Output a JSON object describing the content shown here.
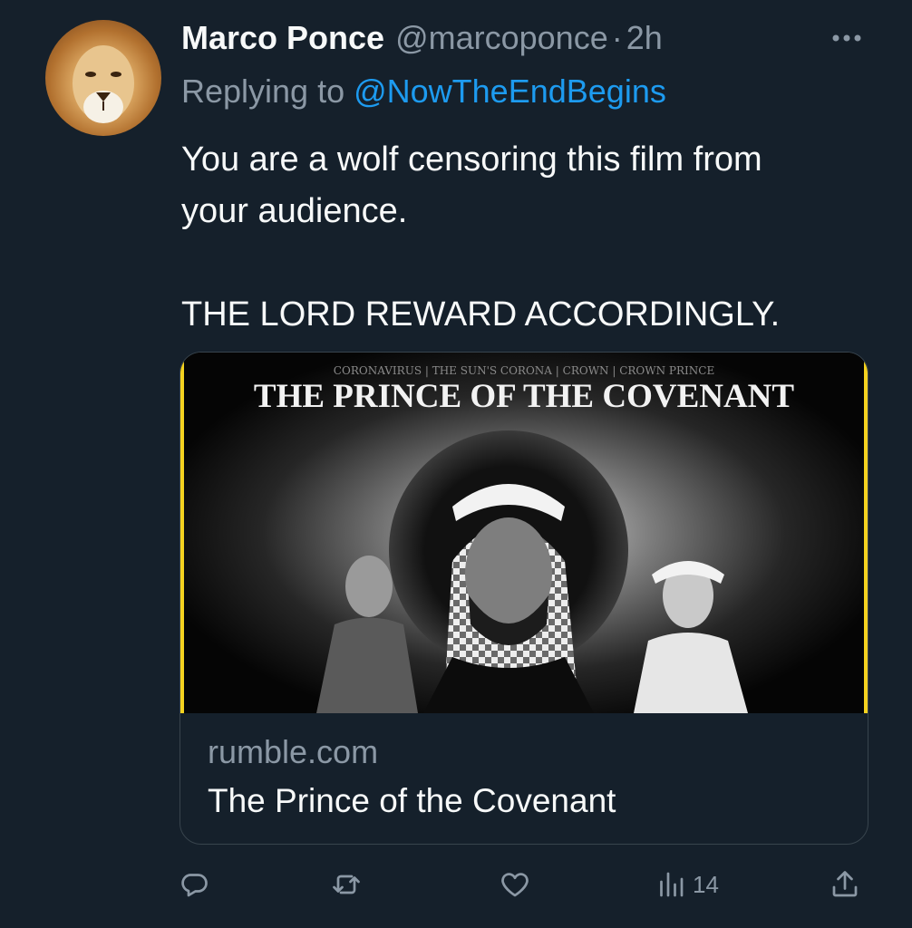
{
  "tweet": {
    "author_name": "Marco Ponce",
    "author_handle": "@marcoponce",
    "separator": "·",
    "time": "2h",
    "replying_prefix": "Replying to ",
    "replying_to": "@NowTheEndBegins",
    "body_lines": [
      "You are a wolf censoring this film from",
      "your audience.",
      "THE LORD REWARD ACCORDINGLY."
    ]
  },
  "card": {
    "image_title": "THE PRINCE OF THE COVENANT",
    "image_subtitle": "CORONAVIRUS | THE SUN'S CORONA | CROWN | CROWN PRINCE",
    "domain": "rumble.com",
    "title": "The Prince of the Covenant"
  },
  "actions": {
    "reply_icon": "reply-icon",
    "retweet_icon": "retweet-icon",
    "like_icon": "heart-icon",
    "views_icon": "views-icon",
    "views_count": "14",
    "share_icon": "share-icon"
  },
  "colors": {
    "background": "#15202b",
    "text": "#f7f9f9",
    "muted": "#8b98a5",
    "accent": "#1d9bf0",
    "border": "#38444d",
    "card_frame": "#f4d21f"
  }
}
